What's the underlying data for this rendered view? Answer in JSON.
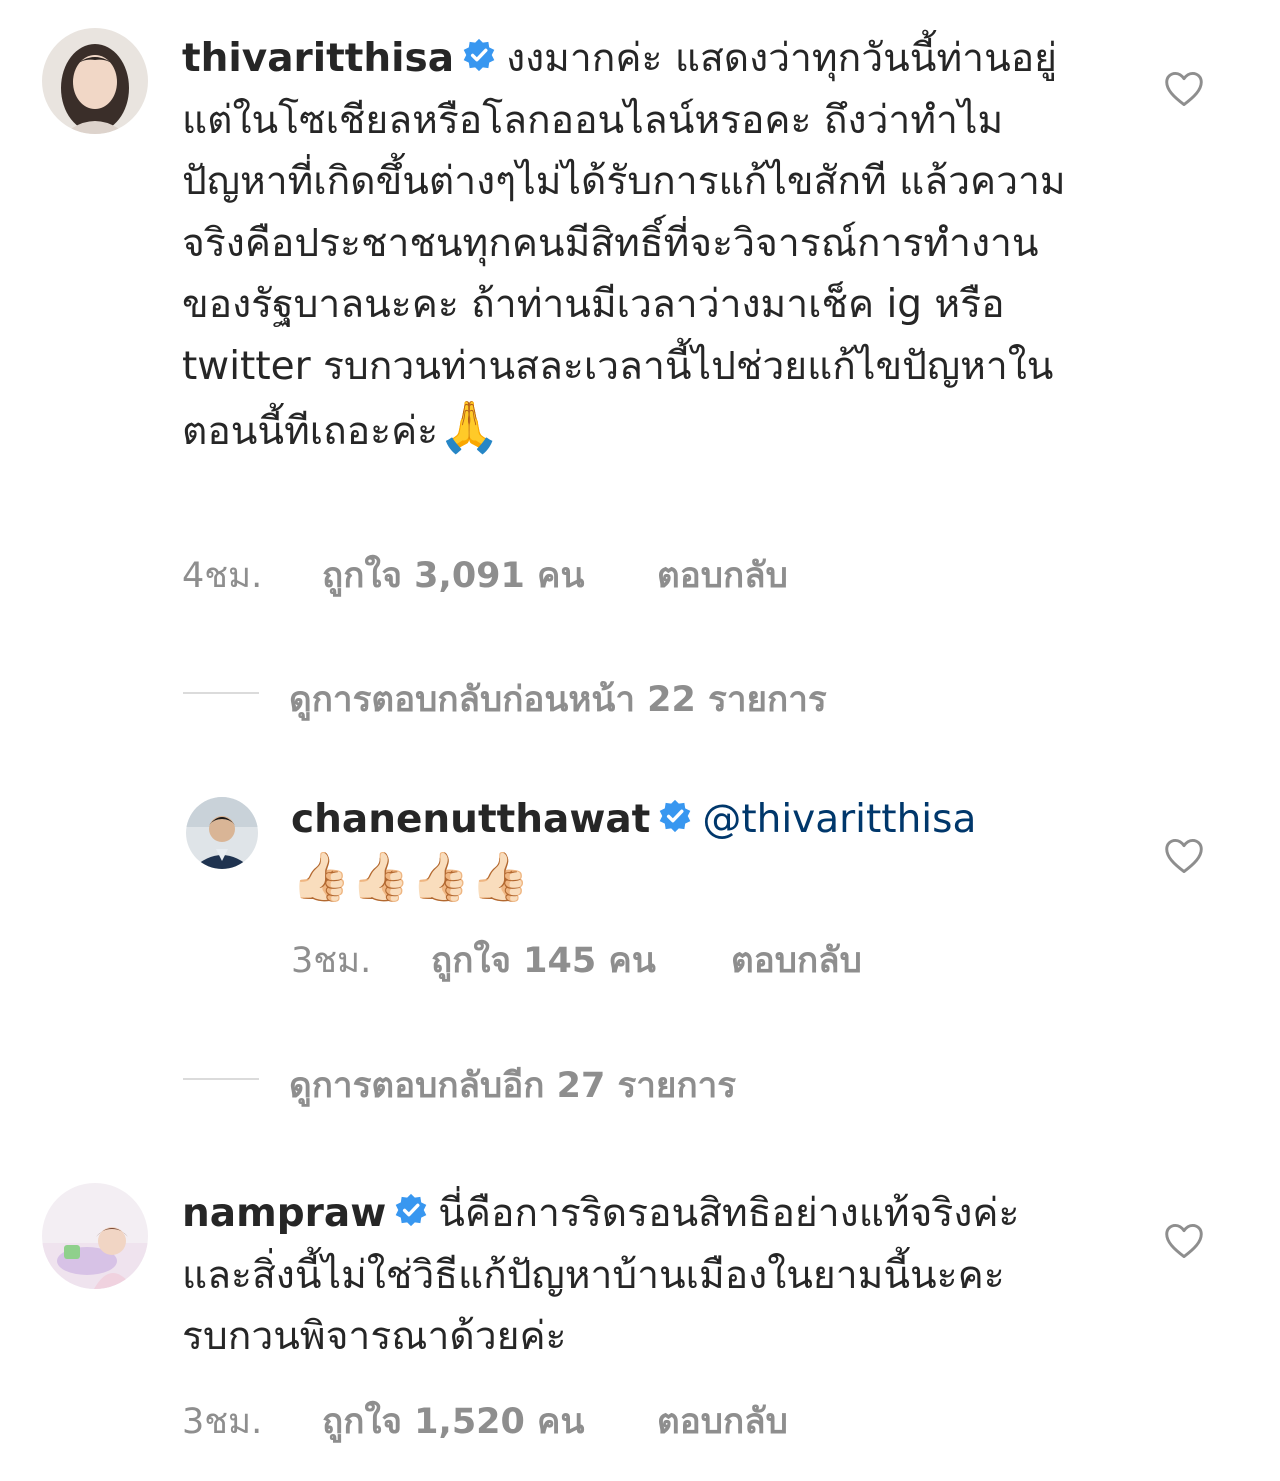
{
  "comments": [
    {
      "username": "thivaritthisa",
      "text": "งงมากค่ะ แสดงว่าทุกวันนี้ท่านอยู่แต่ในโซเชียลหรือโลกออนไลน์หรอคะ ถึงว่าทำไมปัญหาที่เกิดขึ้นต่างๆไม่ได้รับการแก้ไขสักที แล้วความจริงคือประชาชนทุกคนมีสิทธิ์ที่จะวิจารณ์การทำงานของรัฐบาลนะคะ ถ้าท่านมีเวลาว่างมาเช็ค ig หรือ twitter รบกวนท่านสละเวลานี้ไปช่วยแก้ไขปัญหาในตอนนี้ทีเถอะค่ะ",
      "emoji": "🙏",
      "time": "4ชม.",
      "likes": "ถูกใจ 3,091 คน",
      "reply": "ตอบกลับ"
    },
    {
      "username": "chanenutthawat",
      "mention": "@thivaritthisa",
      "emoji": "👍🏻👍🏻👍🏻👍🏻",
      "time": "3ชม.",
      "likes": "ถูกใจ 145 คน",
      "reply": "ตอบกลับ"
    },
    {
      "username": "nampraw",
      "text": "นี่คือการริดรอนสิทธิอย่างแท้จริงค่ะ และสิ่งนี้ไม่ใช่วิธีแก้ปัญหาบ้านเมืองในยามนี้นะคะ รบกวนพิจารณาด้วยค่ะ",
      "time": "3ชม.",
      "likes": "ถูกใจ 1,520 คน",
      "reply": "ตอบกลับ"
    }
  ],
  "view_replies": [
    "ดูการตอบกลับก่อนหน้า 22 รายการ",
    "ดูการตอบกลับอีก 27 รายการ"
  ],
  "icons": {
    "verified": "verified-badge-icon",
    "like": "heart-outline-icon"
  },
  "colors": {
    "text": "#262626",
    "secondary": "#8e8e8e",
    "verified": "#3897f0",
    "mention": "#00376b",
    "divider": "#dbdbdb"
  }
}
